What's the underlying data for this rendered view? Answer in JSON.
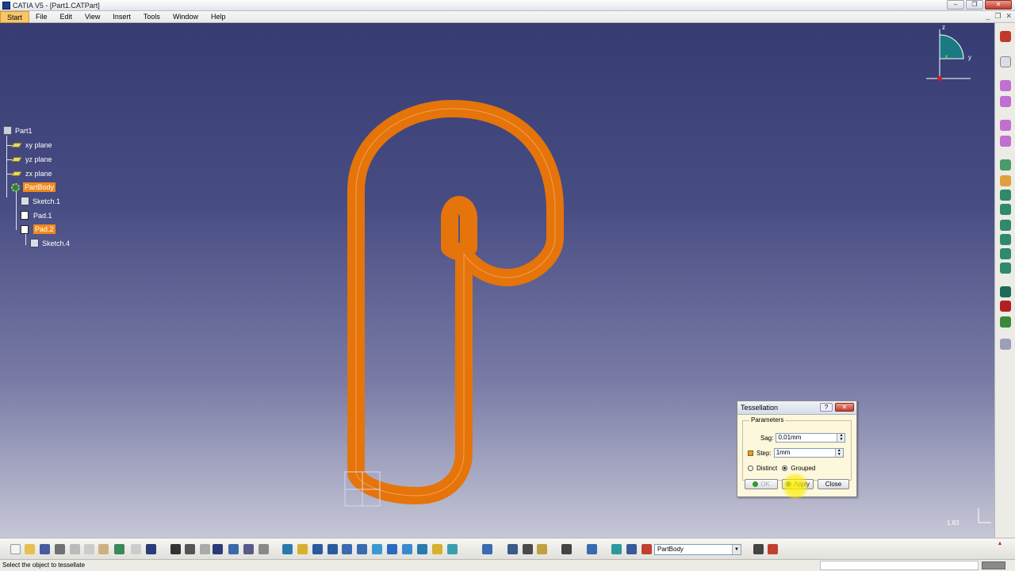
{
  "window": {
    "title": "CATIA V5 - [Part1.CATPart]",
    "controls": [
      "–",
      "❐",
      "✕"
    ]
  },
  "menu": {
    "items": [
      "Start",
      "File",
      "Edit",
      "View",
      "Insert",
      "Tools",
      "Window",
      "Help"
    ],
    "active": "Start"
  },
  "tree": {
    "root": "Part1",
    "xy_plane": "xy plane",
    "yz_plane": "yz plane",
    "zx_plane": "zx plane",
    "part_body": "PartBody",
    "sketch1": "Sketch.1",
    "pad1": "Pad.1",
    "pad2": "Pad.2",
    "sketch4": "Sketch.4"
  },
  "compass": {
    "z": "z",
    "y": "y",
    "x": "x"
  },
  "dialog": {
    "title": "Tessellation",
    "help": "?",
    "close_x": "✕",
    "group_label": "Parameters",
    "sag_label": "Sag:",
    "sag_value": "0,01mm",
    "step_label": "Step:",
    "step_value": "1mm",
    "distinct_label": "Distinct",
    "grouped_label": "Grouped",
    "selected_mode": "Grouped",
    "ok_label": "OK",
    "apply_label": "Apply",
    "close_label": "Close"
  },
  "viewport": {
    "scale": "1.83",
    "model_color": "#e5740b"
  },
  "toolbar": {
    "body_combo": "PartBody"
  },
  "status": {
    "message": "Select the object to tessellate"
  }
}
